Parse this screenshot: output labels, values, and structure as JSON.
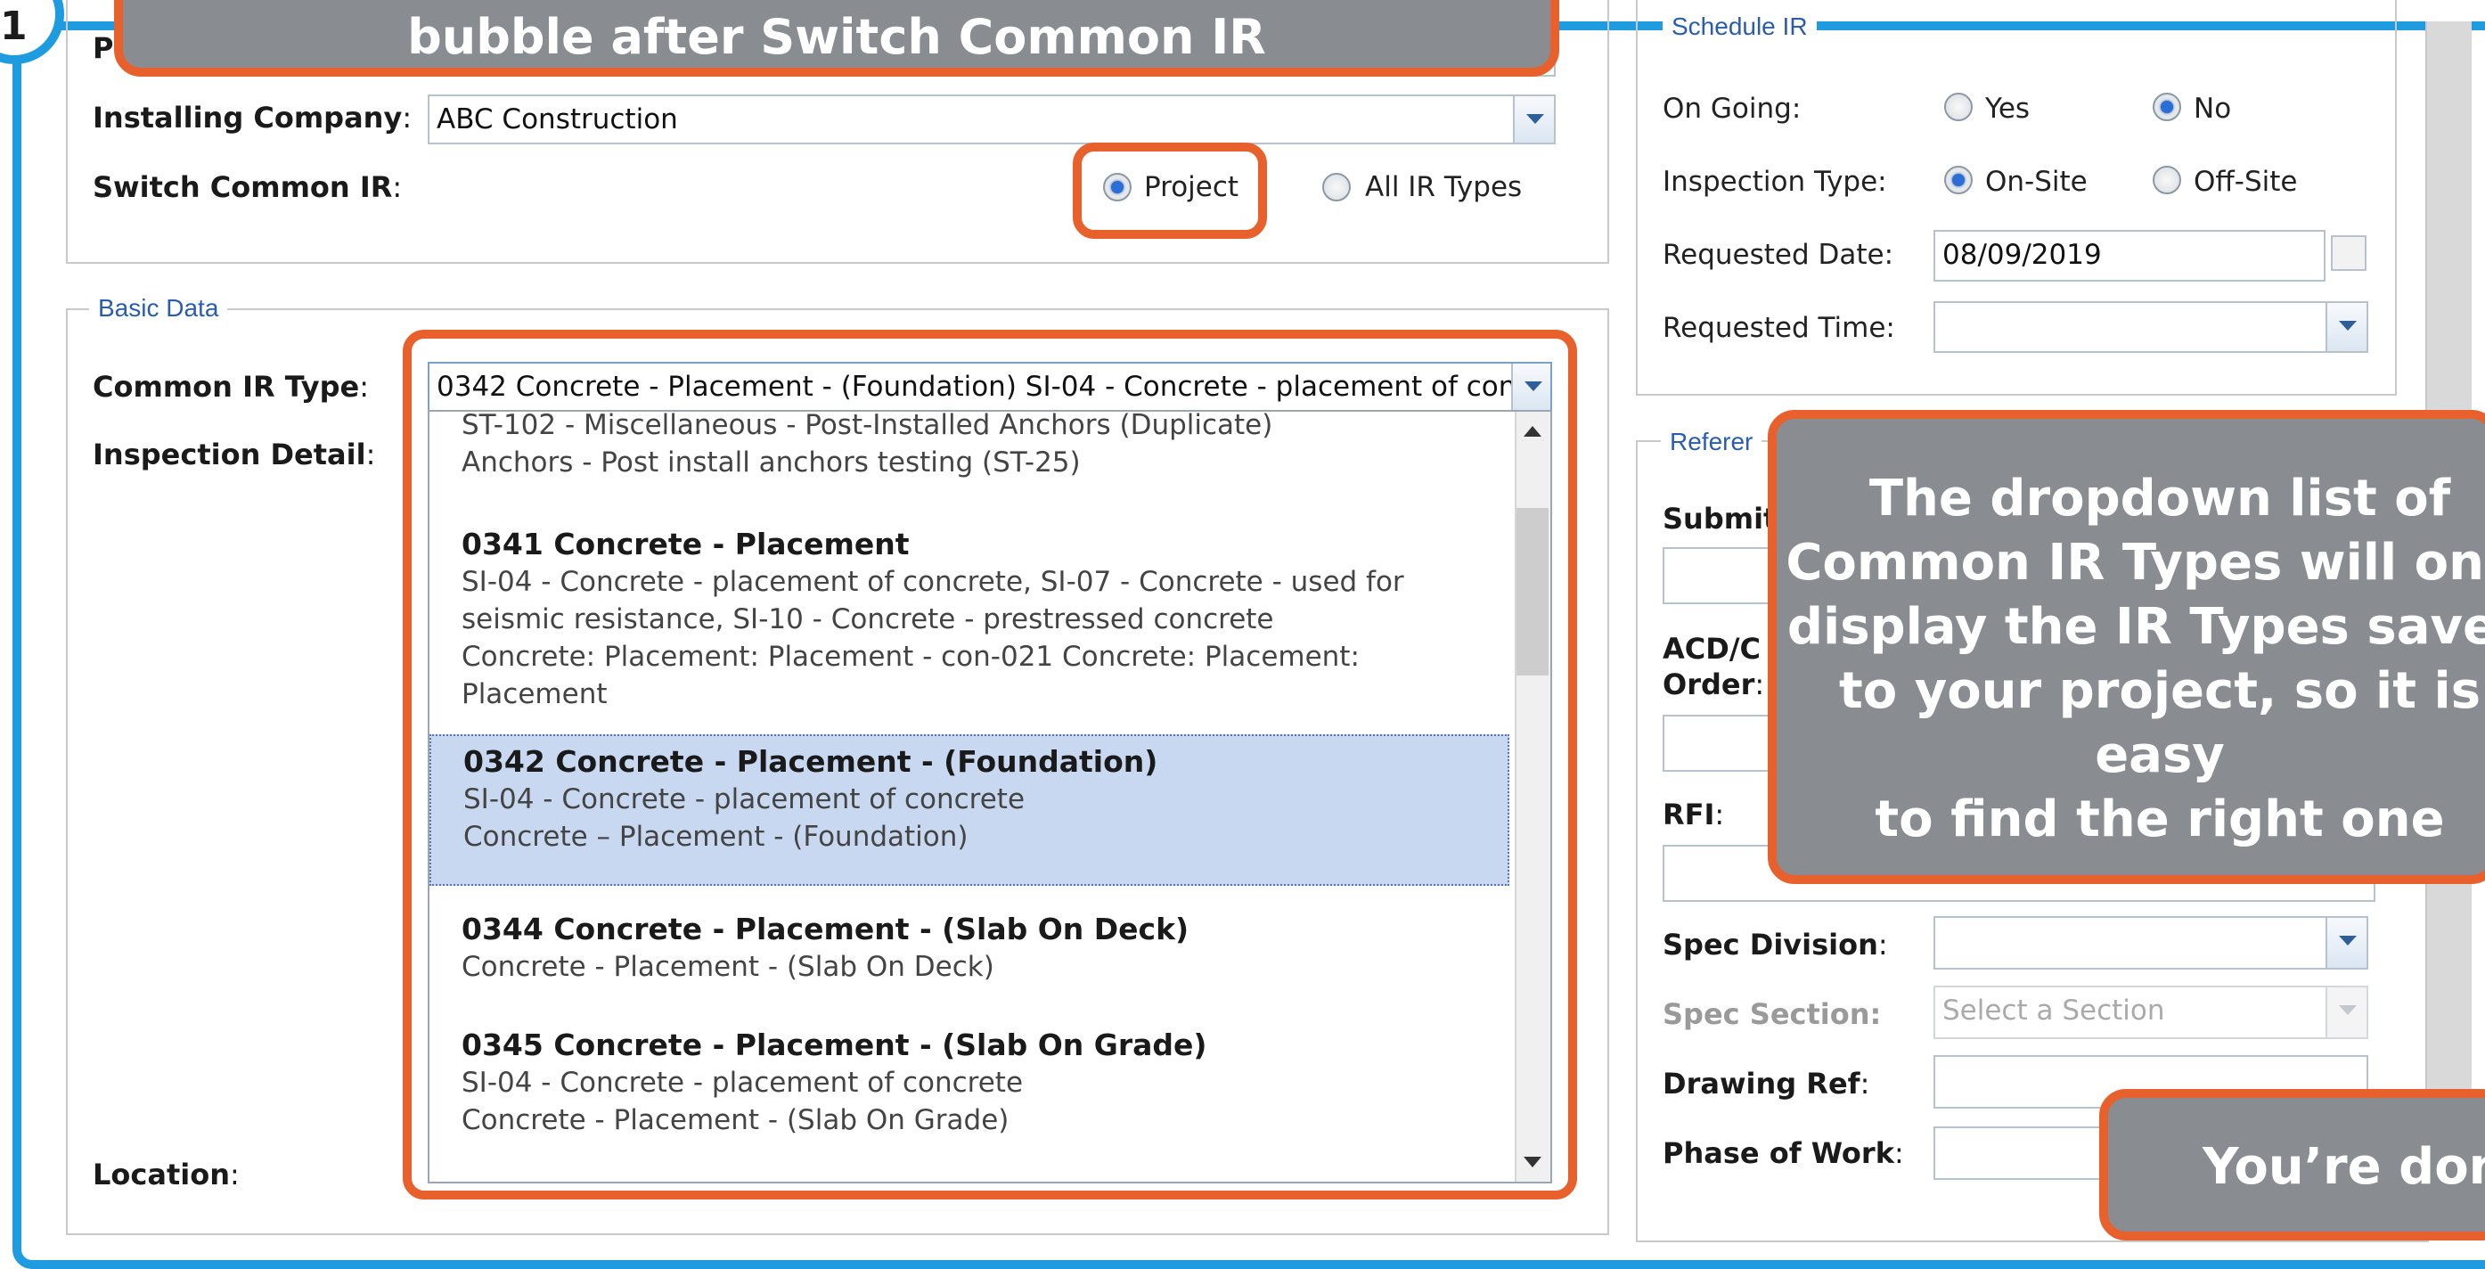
{
  "step_badge": "1",
  "callouts": {
    "top": "bubble after Switch Common IR",
    "dropdown_info": [
      "The dropdown list of",
      "Common IR Types will only",
      "display the IR Types saved",
      "to your project, so it is easy",
      "to find the right one"
    ],
    "done": "You’re done"
  },
  "project_section": {
    "first_label_fragment": "P",
    "installing_company": {
      "label": "Installing Company",
      "value": "ABC Construction"
    },
    "switch_common_ir": {
      "label": "Switch Common IR",
      "options": [
        {
          "label": "Project",
          "selected": true
        },
        {
          "label": "All IR Types",
          "selected": false
        }
      ]
    }
  },
  "basic_data": {
    "legend": "Basic Data",
    "common_ir_type": {
      "label": "Common IR Type",
      "value": "0342 Concrete - Placement - (Foundation) SI-04 - Concrete - placement of con"
    },
    "inspection_detail_label": "Inspection Detail",
    "location_label": "Location",
    "dropdown_items": [
      {
        "title": "",
        "lines": [
          "ST-102 - Miscellaneous - Post-Installed Anchors (Duplicate)",
          "Anchors - Post install anchors testing (ST-25)"
        ],
        "selected": false
      },
      {
        "title": "0341 Concrete - Placement",
        "lines": [
          "SI-04 - Concrete - placement of concrete, SI-07 - Concrete - used for",
          "seismic resistance, SI-10 - Concrete - prestressed concrete",
          "Concrete: Placement: Placement - con-021 Concrete: Placement:",
          "Placement"
        ],
        "selected": false
      },
      {
        "title": "0342 Concrete - Placement - (Foundation)",
        "lines": [
          "SI-04 - Concrete - placement of concrete",
          "Concrete – Placement - (Foundation)"
        ],
        "selected": true
      },
      {
        "title": "0344 Concrete - Placement - (Slab On Deck)",
        "lines": [
          "Concrete - Placement - (Slab On Deck)"
        ],
        "selected": false
      },
      {
        "title": "0345 Concrete - Placement - (Slab On Grade)",
        "lines": [
          "SI-04 - Concrete - placement of concrete",
          "Concrete - Placement - (Slab On Grade)"
        ],
        "selected": false
      }
    ]
  },
  "schedule_ir": {
    "legend": "Schedule IR",
    "on_going": {
      "label": "On Going:",
      "options": [
        {
          "label": "Yes",
          "selected": false
        },
        {
          "label": "No",
          "selected": true
        }
      ]
    },
    "inspection_type": {
      "label": "Inspection Type:",
      "options": [
        {
          "label": "On-Site",
          "selected": true
        },
        {
          "label": "Off-Site",
          "selected": false
        }
      ]
    },
    "requested_date": {
      "label": "Requested Date:",
      "value": "08/09/2019"
    },
    "requested_time": {
      "label": "Requested Time:",
      "value": ""
    }
  },
  "references": {
    "legend": "Referer",
    "submittal_label": "Submit",
    "acd_label_1": "ACD/C",
    "acd_label_2": "Order",
    "rfi_label": "RFI",
    "spec_division_label": "Spec Division",
    "spec_section": {
      "label": "Spec Section:",
      "placeholder": "Select a Section"
    },
    "drawing_ref_label": "Drawing Ref",
    "phase_of_work_label": "Phase of Work"
  },
  "colors": {
    "frame_blue": "#1f9be0",
    "highlight_orange": "#e8602c",
    "callout_gray": "#898d92",
    "legend_blue": "#2a5db0",
    "selection_blue": "#c8d8f0"
  }
}
